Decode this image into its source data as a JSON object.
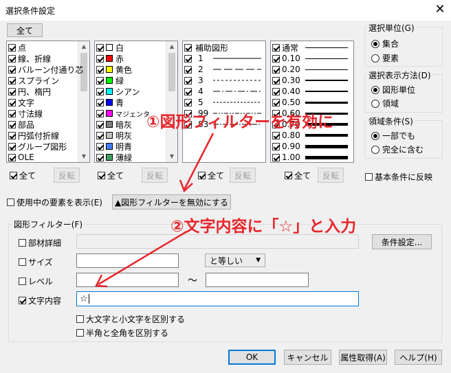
{
  "window": {
    "title": "選択条件設定",
    "close_glyph": "✕"
  },
  "top_all_button": "全て",
  "elements_list": {
    "items": [
      {
        "label": "点",
        "checked": true
      },
      {
        "label": "線、折線",
        "checked": true
      },
      {
        "label": "バルーン付通り芯",
        "checked": true
      },
      {
        "label": "スプライン",
        "checked": true
      },
      {
        "label": "円、楕円",
        "checked": true
      },
      {
        "label": "文字",
        "checked": true
      },
      {
        "label": "寸法線",
        "checked": true
      },
      {
        "label": "部品",
        "checked": true
      },
      {
        "label": "円弧付折線",
        "checked": true
      },
      {
        "label": "グループ図形",
        "checked": true
      },
      {
        "label": "OLE",
        "checked": true
      }
    ]
  },
  "colors_list": {
    "items": [
      {
        "label": "白",
        "color": "#ffffff",
        "checked": true
      },
      {
        "label": "赤",
        "color": "#ff0000",
        "checked": true
      },
      {
        "label": "黄色",
        "color": "#ffff00",
        "checked": true
      },
      {
        "label": "緑",
        "color": "#00ff00",
        "checked": true
      },
      {
        "label": "シアン",
        "color": "#00ffff",
        "checked": true
      },
      {
        "label": "青",
        "color": "#0000ff",
        "checked": true
      },
      {
        "label": "マジェンタ",
        "color": "#ff00ff",
        "checked": true
      },
      {
        "label": "暗灰",
        "color": "#808080",
        "checked": true
      },
      {
        "label": "明灰",
        "color": "#c0c0c0",
        "checked": true
      },
      {
        "label": "明青",
        "color": "#4080ff",
        "checked": true
      },
      {
        "label": "薄緑",
        "color": "#40a060",
        "checked": true
      }
    ]
  },
  "linetypes_list": {
    "items": [
      {
        "label": "補助図形",
        "checked": true
      },
      {
        "label": "1",
        "checked": true
      },
      {
        "label": "2",
        "checked": true
      },
      {
        "label": "3",
        "checked": true
      },
      {
        "label": "4",
        "checked": true
      },
      {
        "label": "5",
        "checked": true
      },
      {
        "label": "99",
        "checked": true
      },
      {
        "label": "83",
        "checked": true
      }
    ]
  },
  "widths_list": {
    "items": [
      {
        "label": "通常",
        "checked": true
      },
      {
        "label": "0.10",
        "checked": true
      },
      {
        "label": "0.20",
        "checked": true
      },
      {
        "label": "0.30",
        "checked": true
      },
      {
        "label": "0.40",
        "checked": true
      },
      {
        "label": "0.50",
        "checked": true
      },
      {
        "label": "0.60",
        "checked": true
      },
      {
        "label": "0.70",
        "checked": true
      },
      {
        "label": "0.80",
        "checked": true
      },
      {
        "label": "0.90",
        "checked": true
      },
      {
        "label": "1.00",
        "checked": true
      }
    ]
  },
  "list_footer": {
    "all_label": "全て",
    "invert_label": "反転"
  },
  "selection_unit": {
    "title": "選択単位(G)",
    "options": [
      "集合",
      "要素"
    ],
    "selected": 0
  },
  "selection_method": {
    "title": "選択表示方法(D)",
    "options": [
      "図形単位",
      "領域"
    ],
    "selected": 0
  },
  "area_condition": {
    "title": "領域条件(S)",
    "options": [
      "一部でも",
      "完全に含む"
    ],
    "selected": 0
  },
  "reflect_basic": {
    "label": "基本条件に反映"
  },
  "show_in_use": {
    "label": "使用中の要素を表示(E)"
  },
  "disable_filter_button": "▲図形フィルターを無効にする",
  "filter": {
    "title": "図形フィルター(F)",
    "material_detail": "部材詳細",
    "condition_button": "条件設定...",
    "size": "サイズ",
    "size_op": "と等しい",
    "level": "レベル",
    "tilde": "〜",
    "text_content": "文字内容",
    "text_value": "☆",
    "case_sensitive": "大文字と小文字を区別する",
    "width_sensitive": "半角と全角を区別する"
  },
  "buttons": {
    "ok": "OK",
    "cancel": "キャンセル",
    "get_attr": "属性取得(A)",
    "help": "ヘルプ(H)"
  },
  "annotations": {
    "step1": "①図形フィルターを有効に",
    "step2": "②文字内容に「☆」と入力",
    "color": "#e8252b"
  }
}
